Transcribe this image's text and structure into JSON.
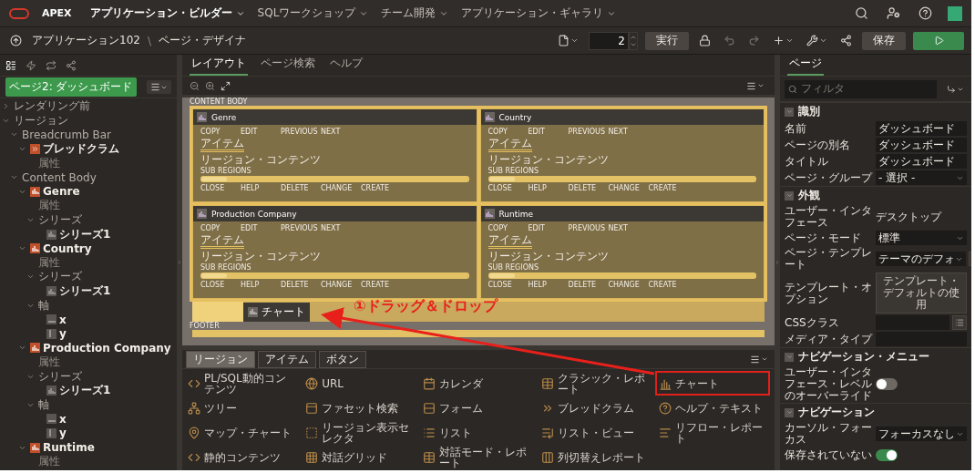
{
  "header": {
    "logo_text": "APEX",
    "nav": [
      {
        "label": "アプリケーション・ビルダー",
        "selected": true
      },
      {
        "label": "SQLワークショップ",
        "selected": false
      },
      {
        "label": "チーム開発",
        "selected": false
      },
      {
        "label": "アプリケーション・ギャラリ",
        "selected": false
      }
    ]
  },
  "toolbar": {
    "breadcrumb": [
      "アプリケーション102",
      "ページ・デザイナ"
    ],
    "separator": "\\",
    "page_number": "2",
    "run_label": "実行",
    "save_label": "保存"
  },
  "left_panel": {
    "tabs": [
      {
        "kind": "rendering",
        "selected": true
      },
      {
        "kind": "dynamic",
        "selected": false
      },
      {
        "kind": "processing",
        "selected": false
      },
      {
        "kind": "shared",
        "selected": false
      }
    ],
    "page_badge": "ページ2: ダッシュボード",
    "tree": [
      {
        "label": "レンダリング前",
        "kind": "group",
        "expanded": false
      },
      {
        "label": "リージョン",
        "kind": "group",
        "expanded": true,
        "children": [
          {
            "label": "Breadcrumb Bar",
            "kind": "group",
            "expanded": true,
            "children": [
              {
                "label": "ブレッドクラム",
                "kind": "breadcrumb",
                "expanded": true,
                "children": [
                  {
                    "label": "属性",
                    "kind": "attr"
                  }
                ]
              }
            ]
          },
          {
            "label": "Content Body",
            "kind": "group",
            "expanded": true,
            "children": [
              {
                "label": "Genre",
                "kind": "chart",
                "expanded": true,
                "children": [
                  {
                    "label": "属性",
                    "kind": "attr"
                  },
                  {
                    "label": "シリーズ",
                    "kind": "group",
                    "expanded": true,
                    "children": [
                      {
                        "label": "シリーズ1",
                        "kind": "series"
                      }
                    ]
                  }
                ]
              },
              {
                "label": "Country",
                "kind": "chart",
                "expanded": true,
                "children": [
                  {
                    "label": "属性",
                    "kind": "attr"
                  },
                  {
                    "label": "シリーズ",
                    "kind": "group",
                    "expanded": true,
                    "children": [
                      {
                        "label": "シリーズ1",
                        "kind": "series"
                      }
                    ]
                  },
                  {
                    "label": "軸",
                    "kind": "group",
                    "expanded": true,
                    "children": [
                      {
                        "label": "x",
                        "kind": "axis-x"
                      },
                      {
                        "label": "y",
                        "kind": "axis-y"
                      }
                    ]
                  }
                ]
              },
              {
                "label": "Production Company",
                "kind": "chart",
                "expanded": true,
                "children": [
                  {
                    "label": "属性",
                    "kind": "attr"
                  },
                  {
                    "label": "シリーズ",
                    "kind": "group",
                    "expanded": true,
                    "children": [
                      {
                        "label": "シリーズ1",
                        "kind": "series"
                      }
                    ]
                  },
                  {
                    "label": "軸",
                    "kind": "group",
                    "expanded": true,
                    "children": [
                      {
                        "label": "x",
                        "kind": "axis-x"
                      },
                      {
                        "label": "y",
                        "kind": "axis-y"
                      }
                    ]
                  }
                ]
              },
              {
                "label": "Runtime",
                "kind": "chart",
                "expanded": true,
                "children": [
                  {
                    "label": "属性",
                    "kind": "attr"
                  }
                ]
              }
            ]
          }
        ]
      }
    ]
  },
  "center": {
    "tabs": [
      {
        "label": "レイアウト",
        "selected": true
      },
      {
        "label": "ページ検索",
        "selected": false
      },
      {
        "label": "ヘルプ",
        "selected": false
      }
    ],
    "canvas": {
      "body_label": "CONTENT BODY",
      "regions": [
        {
          "title": "Genre",
          "top_buttons": [
            "COPY",
            "EDIT",
            "PREVIOUS",
            "NEXT"
          ],
          "item_label": "アイテム",
          "content_label": "リージョン・コンテンツ",
          "sub_label": "SUB REGIONS",
          "bottom_buttons": [
            "CLOSE",
            "HELP",
            "DELETE",
            "CHANGE",
            "CREATE"
          ]
        },
        {
          "title": "Country",
          "top_buttons": [
            "COPY",
            "EDIT",
            "PREVIOUS",
            "NEXT"
          ],
          "item_label": "アイテム",
          "content_label": "リージョン・コンテンツ",
          "sub_label": "SUB REGIONS",
          "bottom_buttons": [
            "CLOSE",
            "HELP",
            "DELETE",
            "CHANGE",
            "CREATE"
          ]
        },
        {
          "title": "Production Company",
          "top_buttons": [
            "COPY",
            "EDIT",
            "PREVIOUS",
            "NEXT"
          ],
          "item_label": "アイテム",
          "content_label": "リージョン・コンテンツ",
          "sub_label": "SUB REGIONS",
          "bottom_buttons": [
            "CLOSE",
            "HELP",
            "DELETE",
            "CHANGE",
            "CREATE"
          ]
        },
        {
          "title": "Runtime",
          "top_buttons": [
            "COPY",
            "EDIT",
            "PREVIOUS",
            "NEXT"
          ],
          "item_label": "アイテム",
          "content_label": "リージョン・コンテンツ",
          "sub_label": "SUB REGIONS",
          "bottom_buttons": [
            "CLOSE",
            "HELP",
            "DELETE",
            "CHANGE",
            "CREATE"
          ]
        }
      ],
      "drop_zone": {
        "dragged_item": "チャート"
      },
      "footer_label": "FOOTER"
    }
  },
  "gallery": {
    "tabs": [
      {
        "label": "リージョン",
        "selected": true
      },
      {
        "label": "アイテム",
        "selected": false
      },
      {
        "label": "ボタン",
        "selected": false
      }
    ],
    "items": [
      {
        "label": "PL/SQL動的コンテンツ",
        "kind": "code",
        "highlighted": false
      },
      {
        "label": "URL",
        "kind": "url",
        "highlighted": false
      },
      {
        "label": "カレンダ",
        "kind": "calendar",
        "highlighted": false
      },
      {
        "label": "クラシック・レポート",
        "kind": "table",
        "highlighted": false
      },
      {
        "label": "チャート",
        "kind": "chart",
        "highlighted": true
      },
      {
        "label": "ツリー",
        "kind": "tree",
        "highlighted": false
      },
      {
        "label": "ファセット検索",
        "kind": "panel",
        "highlighted": false
      },
      {
        "label": "フォーム",
        "kind": "form",
        "highlighted": false
      },
      {
        "label": "ブレッドクラム",
        "kind": "breadcrumb",
        "highlighted": false
      },
      {
        "label": "ヘルプ・テキスト",
        "kind": "help",
        "highlighted": false
      },
      {
        "label": "マップ・チャート",
        "kind": "map",
        "highlighted": false
      },
      {
        "label": "リージョン表示セレクタ",
        "kind": "selector",
        "highlighted": false
      },
      {
        "label": "リスト",
        "kind": "list",
        "highlighted": false
      },
      {
        "label": "リスト・ビュー",
        "kind": "listview",
        "highlighted": false
      },
      {
        "label": "リフロー・レポート",
        "kind": "reflow",
        "highlighted": false
      },
      {
        "label": "静的コンテンツ",
        "kind": "static",
        "highlighted": false
      },
      {
        "label": "対話グリッド",
        "kind": "grid",
        "highlighted": false
      },
      {
        "label": "対話モード・レポート",
        "kind": "report",
        "highlighted": false
      },
      {
        "label": "列切替えレポート",
        "kind": "columns",
        "highlighted": false
      }
    ]
  },
  "annotation": {
    "text": "①ドラッグ＆ドロップ"
  },
  "right_panel": {
    "tab": {
      "label": "ページ",
      "selected": true
    },
    "filter_placeholder": "フィルタ",
    "sections": [
      {
        "title": "識別",
        "expanded": true,
        "properties": [
          {
            "label": "名前",
            "kind": "text",
            "value": "ダッシュボード"
          },
          {
            "label": "ページの別名",
            "kind": "text",
            "value": "ダッシュボード"
          },
          {
            "label": "タイトル",
            "kind": "text",
            "value": "ダッシュボード"
          },
          {
            "label": "ページ・グループ",
            "kind": "select",
            "value": "- 選択 -"
          }
        ]
      },
      {
        "title": "外観",
        "expanded": true,
        "properties": [
          {
            "label": "ユーザー・インタフェース",
            "kind": "static",
            "value": "デスクトップ"
          },
          {
            "label": "ページ・モード",
            "kind": "select",
            "value": "標準"
          },
          {
            "label": "ページ・テンプレート",
            "kind": "select-link",
            "value": "テーマのデフォ"
          },
          {
            "label": "テンプレート・オプション",
            "kind": "button",
            "value": "テンプレート・デフォルトの使用"
          },
          {
            "label": "CSSクラス",
            "kind": "text-list"
          },
          {
            "label": "メディア・タイプ",
            "kind": "text"
          }
        ]
      },
      {
        "title": "ナビゲーション・メニュー",
        "expanded": true,
        "properties": [
          {
            "label": "ユーザー・インタフェース・レベルのオーバーライド",
            "kind": "switch",
            "on": false
          }
        ]
      },
      {
        "title": "ナビゲーション",
        "expanded": true,
        "properties": [
          {
            "label": "カーソル・フォーカス",
            "kind": "select",
            "value": "フォーカスなし"
          },
          {
            "label": "保存されていない",
            "kind": "switch",
            "on": true
          }
        ]
      }
    ]
  }
}
